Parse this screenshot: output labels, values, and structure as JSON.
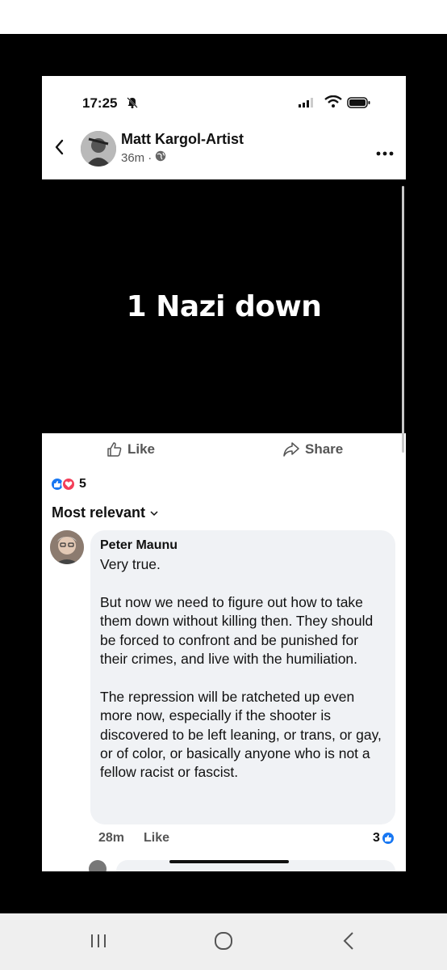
{
  "status": {
    "time": "17:25"
  },
  "post": {
    "author": "Matt Kargol-Artist",
    "time": "36m",
    "image_text": "1 Nazi down",
    "like_label": "Like",
    "share_label": "Share",
    "reaction_count": "5"
  },
  "comments": {
    "sort_label": "Most relevant",
    "items": [
      {
        "name": "Peter Maunu",
        "text": "Very true.\n\nBut now we need to figure out how to take them down without killing then. They should be forced to confront and be punished for their crimes, and live with the humiliation.\n\nThe repression will be ratcheted up even more now, especially if the shooter is discovered to be left leaning, or trans, or gay, or of color, or basically anyone who is not a fellow racist or fascist.",
        "time": "28m",
        "like_label": "Like",
        "reaction_count": "3"
      }
    ]
  },
  "icons": {
    "bell": "bell-muted-icon",
    "signal": "signal-icon",
    "wifi": "wifi-icon",
    "battery": "battery-icon",
    "back": "chevron-left-icon",
    "globe": "globe-icon",
    "more": "more-icon",
    "like": "thumbs-up-icon",
    "share": "share-icon"
  },
  "colors": {
    "accent": "#1877f2",
    "love": "#f33e58",
    "bubble": "#f0f2f5"
  }
}
